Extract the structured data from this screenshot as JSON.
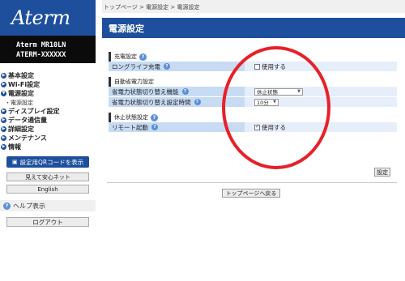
{
  "sidebar": {
    "logo": "Aterm",
    "model_line1": "Aterm  MR10LN",
    "model_line2": "ATERM-XXXXXX",
    "menu": [
      {
        "label": "基本設定"
      },
      {
        "label": "Wi-Fi設定"
      },
      {
        "label": "電源設定"
      },
      {
        "label": "ディスプレイ設定"
      },
      {
        "label": "データ通信量"
      },
      {
        "label": "詳細設定"
      },
      {
        "label": "メンテナンス"
      },
      {
        "label": "情報"
      }
    ],
    "submenu_power": "・電源設定",
    "qr_button": "設定用QRコードを表示",
    "anshin_button": "見えて安心ネット",
    "english_button": "English",
    "help_label": "ヘルプ表示",
    "logout_button": "ログアウト"
  },
  "breadcrumb": "トップページ > 電源設定 > 電源設定",
  "page_title": "電源設定",
  "sections": [
    {
      "title": "充電設定",
      "rows": [
        {
          "label": "ロングライフ充電",
          "value": "使用する",
          "control": "checkbox",
          "checked": false
        }
      ]
    },
    {
      "title": "自動省電力設定",
      "rows": [
        {
          "label": "省電力状態切り替え機能",
          "value": "休止状態",
          "control": "select"
        },
        {
          "label": "省電力状態切り替え設定時間",
          "value": "10分",
          "control": "select"
        }
      ]
    },
    {
      "title": "休止状態設定",
      "rows": [
        {
          "label": "リモート起動",
          "value": "使用する",
          "control": "checkbox",
          "checked": true
        }
      ]
    }
  ],
  "settings_button": "設定",
  "top_page_button": "トップページへ戻る",
  "colors": {
    "brand_blue": "#1d4f9c",
    "label_bg": "#c7dbf3",
    "value_bg": "#e6eefa",
    "annotation_red": "#e8202a"
  }
}
